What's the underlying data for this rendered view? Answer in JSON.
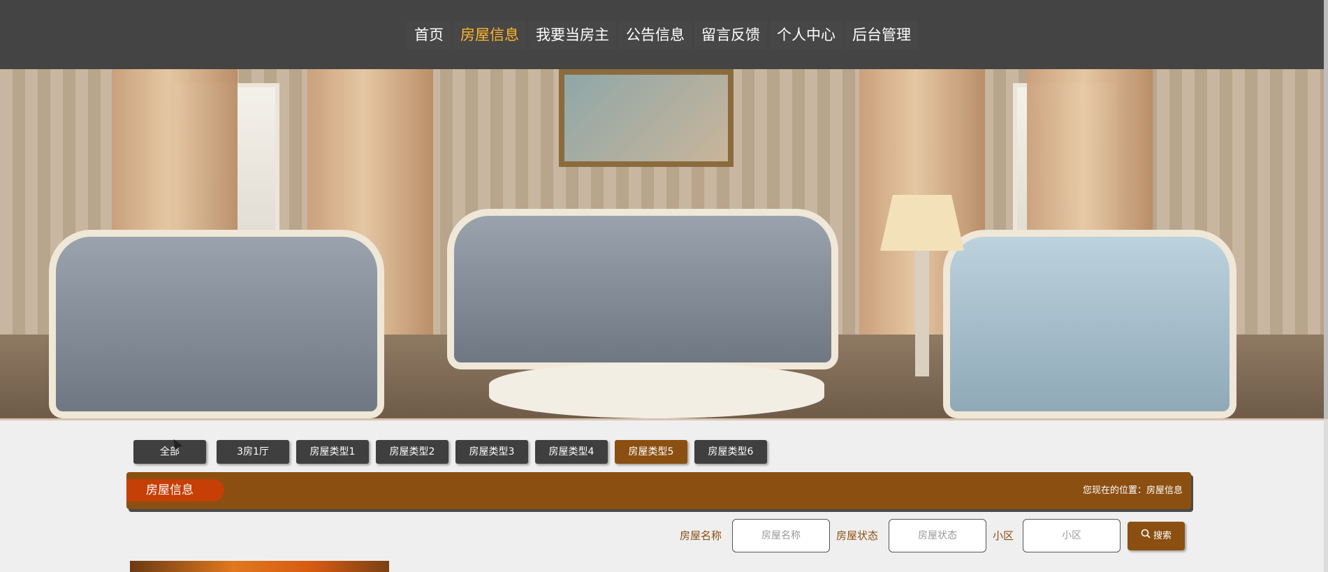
{
  "nav": {
    "items": [
      {
        "label": "首页",
        "active": false
      },
      {
        "label": "房屋信息",
        "active": true
      },
      {
        "label": "我要当房主",
        "active": false
      },
      {
        "label": "公告信息",
        "active": false
      },
      {
        "label": "留言反馈",
        "active": false
      },
      {
        "label": "个人中心",
        "active": false
      },
      {
        "label": "后台管理",
        "active": false
      }
    ],
    "active_color": "#ffb52b",
    "bg_color": "#444444"
  },
  "categories": {
    "items": [
      {
        "label": "全部",
        "active": false
      },
      {
        "label": "3房1厅",
        "active": false
      },
      {
        "label": "房屋类型1",
        "active": false
      },
      {
        "label": "房屋类型2",
        "active": false
      },
      {
        "label": "房屋类型3",
        "active": false
      },
      {
        "label": "房屋类型4",
        "active": false
      },
      {
        "label": "房屋类型5",
        "active": true
      },
      {
        "label": "房屋类型6",
        "active": false
      }
    ],
    "active_color": "#8b4f11"
  },
  "section": {
    "title": "房屋信息",
    "breadcrumb": "您现在的位置：房屋信息"
  },
  "search": {
    "fields": [
      {
        "label": "房屋名称",
        "placeholder": "房屋名称",
        "value": ""
      },
      {
        "label": "房屋状态",
        "placeholder": "房屋状态",
        "value": ""
      },
      {
        "label": "小区",
        "placeholder": "小区",
        "value": ""
      }
    ],
    "button_label": "搜索",
    "button_icon": "search-icon"
  },
  "colors": {
    "brand": "#8b4f11",
    "title_tag": "#c53f06"
  }
}
